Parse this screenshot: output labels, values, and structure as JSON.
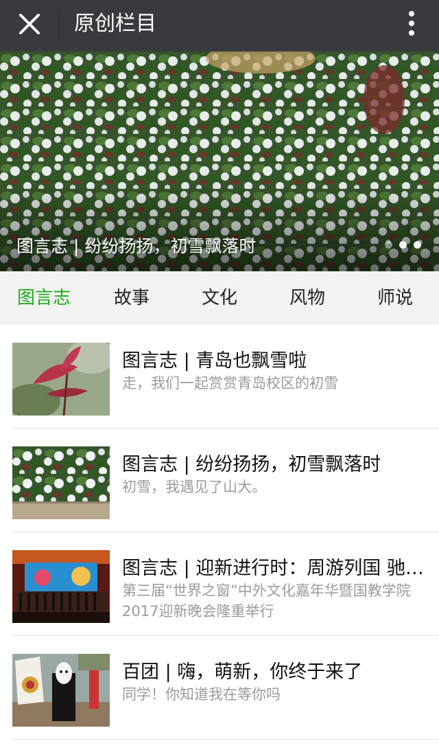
{
  "header": {
    "title": "原创栏目",
    "close_icon": "close-icon",
    "more_icon": "more-vertical-icon"
  },
  "banner": {
    "caption": "图言志 | 纷纷扬扬，初雪飘落时",
    "slide_count": 3,
    "active_slide": 2
  },
  "tabs": [
    {
      "label": "图言志",
      "active": true
    },
    {
      "label": "故事",
      "active": false
    },
    {
      "label": "文化",
      "active": false
    },
    {
      "label": "风物",
      "active": false
    },
    {
      "label": "师说",
      "active": false
    }
  ],
  "articles": [
    {
      "title": "图言志 | 青岛也飘雪啦",
      "desc": "走，我们一起赏赏青岛校区的初雪"
    },
    {
      "title": "图言志 | 纷纷扬扬，初雪飘落时",
      "desc": "初雪，我遇见了山大。"
    },
    {
      "title": "图言志 | 迎新进行时：周游列国 驰骋天下",
      "desc": "第三届“世界之窗”中外文化嘉年华暨国教学院2017迎新晚会隆重举行"
    },
    {
      "title": "百团 | 嗨，萌新，你终于来了",
      "desc": "同学！你知道我在等你吗"
    }
  ],
  "colors": {
    "topbar_bg": "#393a3f",
    "active_tab": "#1aad19",
    "tab_bar_bg": "#f3f3f3",
    "desc_text": "#9a9a9a"
  }
}
